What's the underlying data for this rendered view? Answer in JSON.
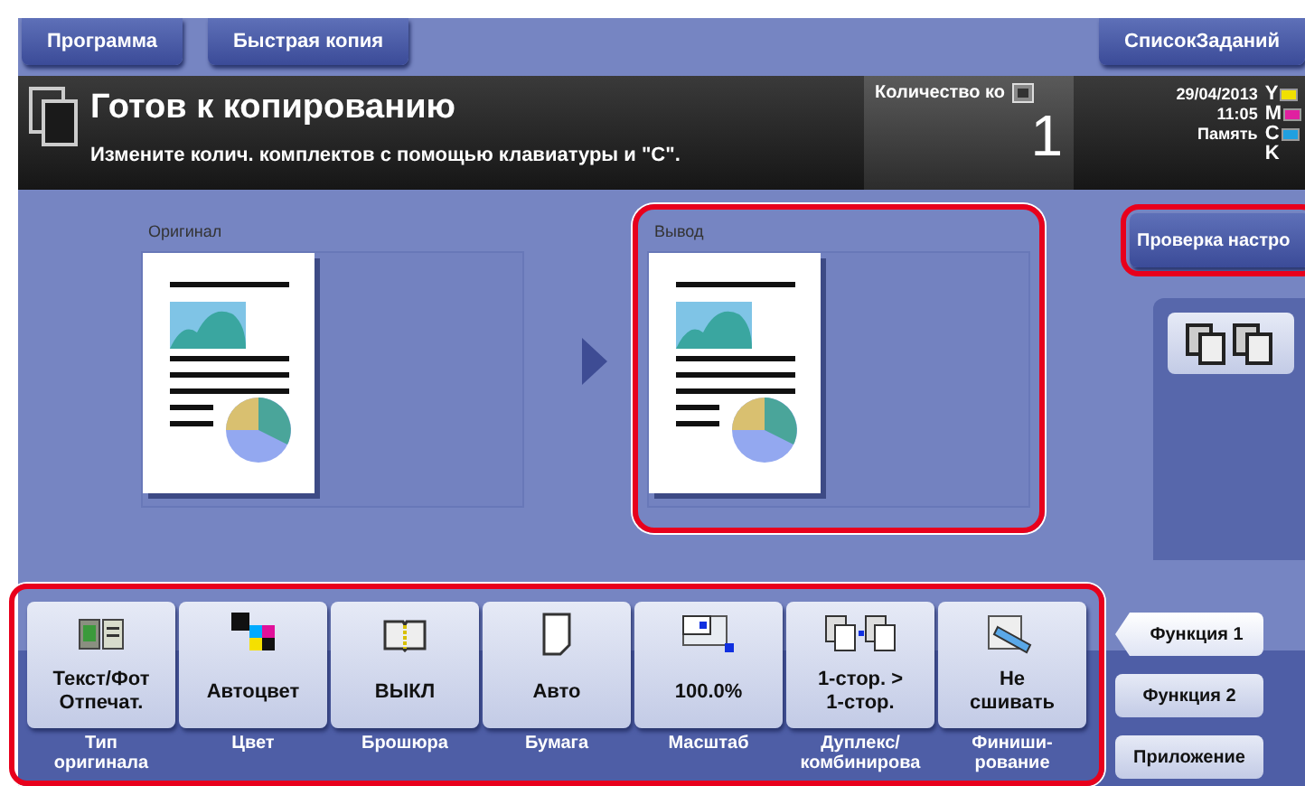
{
  "top_buttons": [
    {
      "label": "Программа"
    },
    {
      "label": "Быстрая копия"
    }
  ],
  "job_list_button": {
    "label": "СписокЗаданий"
  },
  "status": {
    "title": "Готов к копированию",
    "message": "Измените колич. комплектов с помощью клавиатуры и \"С\".",
    "count_label": "Количество ко",
    "count": "1",
    "date": "29/04/2013",
    "time": "11:05",
    "memory_label": "Память",
    "toners": [
      {
        "name": "Y",
        "color": "#f0e000"
      },
      {
        "name": "M",
        "color": "#e020a0"
      },
      {
        "name": "C",
        "color": "#20a0e0"
      },
      {
        "name": "K"
      }
    ]
  },
  "settings_check_button": {
    "label": "Проверка настро",
    "highlighted": true
  },
  "previews": [
    {
      "label": "Оригинал",
      "highlighted": false
    },
    {
      "label": "Вывод",
      "highlighted": true
    }
  ],
  "function_bar_highlighted": true,
  "function_keys": [
    {
      "kind": "original-type",
      "value": "Текст/Фот\nОтпечат.",
      "label": "Тип\nоригинала"
    },
    {
      "kind": "color",
      "value": "Автоцвет",
      "label": "Цвет"
    },
    {
      "kind": "booklet",
      "value": "ВЫКЛ",
      "label": "Брошюра"
    },
    {
      "kind": "paper",
      "value": "Авто",
      "label": "Бумага"
    },
    {
      "kind": "zoom",
      "value": "100.0%",
      "label": "Масштаб"
    },
    {
      "kind": "duplex",
      "value": "1-стор. >\n1-стор.",
      "label": "Дуплекс/\nкомбинирова"
    },
    {
      "kind": "finishing",
      "value": "Не\nсшивать",
      "label": "Финиши-\nрование"
    }
  ],
  "function_tabs": [
    {
      "label": "Функция 1",
      "selected": true
    },
    {
      "label": "Функция 2",
      "selected": false
    },
    {
      "label": "Приложение",
      "selected": false
    }
  ]
}
